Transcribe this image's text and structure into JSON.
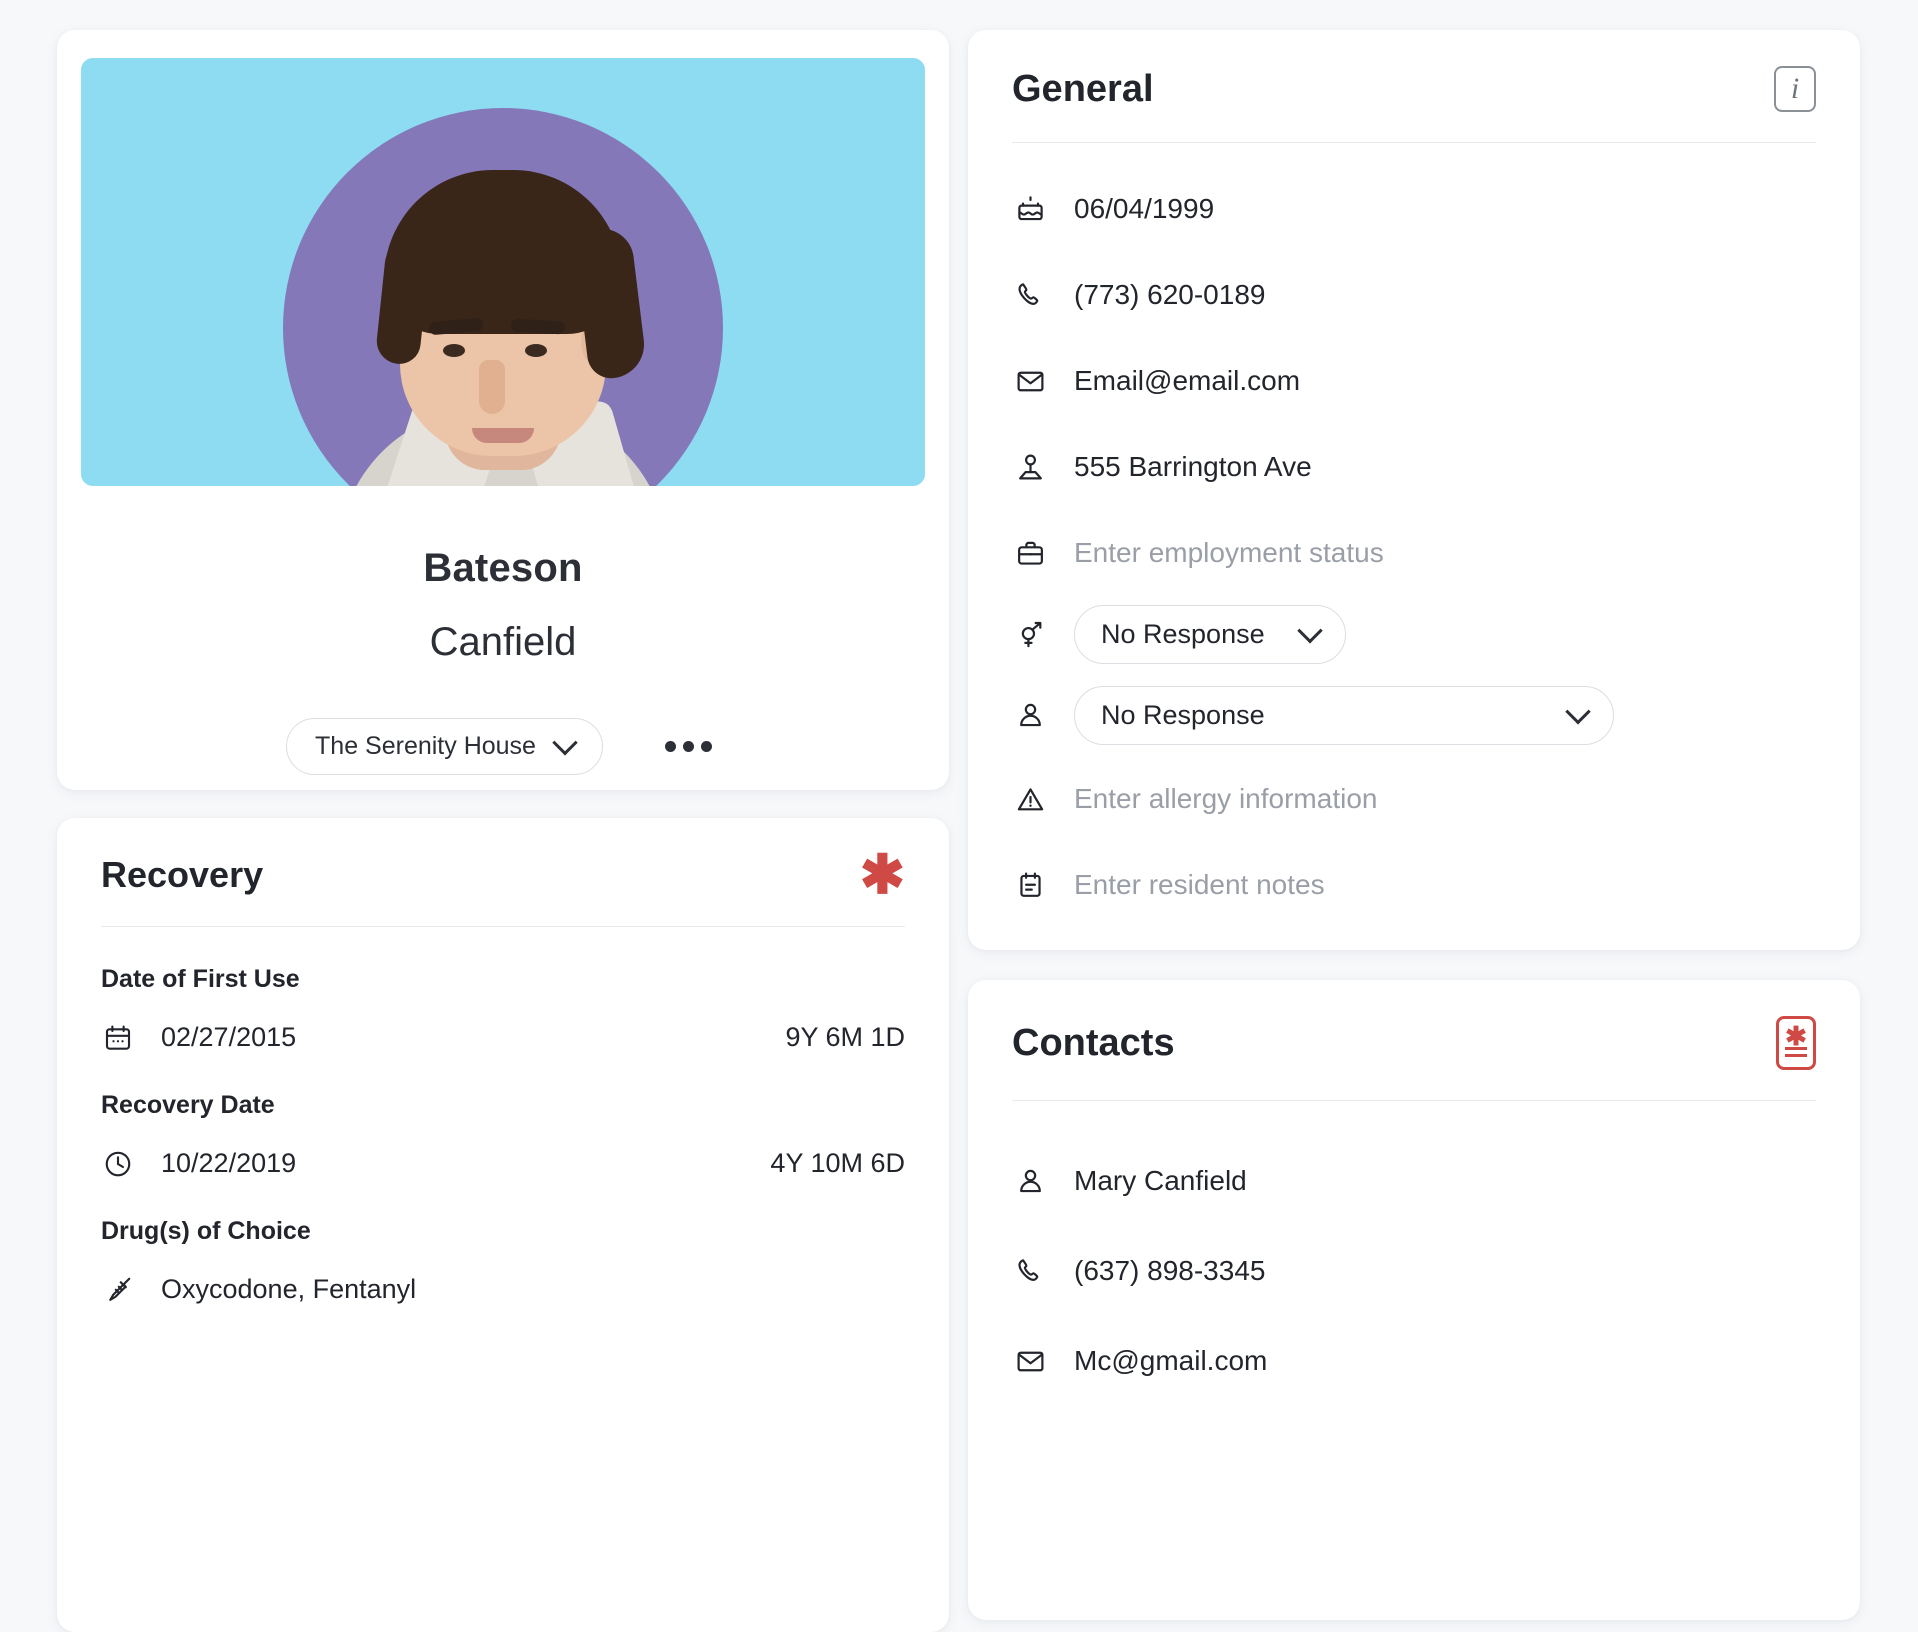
{
  "profile": {
    "first_name": "Bateson",
    "last_name": "Canfield",
    "house_select": "The Serenity House",
    "more_label": "•••",
    "banner_color": "#8edcf2",
    "avatar_bg_color": "#8478b8"
  },
  "recovery": {
    "title": "Recovery",
    "required_marker": "✱",
    "sections": [
      {
        "label": "Date of First Use",
        "icon": "calendar-icon",
        "value": "02/27/2015",
        "duration": "9Y 6M 1D"
      },
      {
        "label": "Recovery Date",
        "icon": "clock-icon",
        "value": "10/22/2019",
        "duration": "4Y 10M 6D"
      },
      {
        "label": "Drug(s) of Choice",
        "icon": "syringe-icon",
        "value": "Oxycodone, Fentanyl",
        "duration": ""
      }
    ]
  },
  "general": {
    "title": "General",
    "info_icon_label": "i",
    "rows": [
      {
        "icon": "birthday-cake-icon",
        "value": "06/04/1999",
        "placeholder": false
      },
      {
        "icon": "phone-icon",
        "value": "(773) 620-0189",
        "placeholder": false
      },
      {
        "icon": "envelope-icon",
        "value": "Email@email.com",
        "placeholder": false
      },
      {
        "icon": "location-pin-person-icon",
        "value": "555 Barrington Ave",
        "placeholder": false
      },
      {
        "icon": "briefcase-icon",
        "value": "Enter employment status",
        "placeholder": true
      }
    ],
    "gender_select": {
      "icon": "gender-intersex-icon",
      "value": "No Response"
    },
    "pronoun_select": {
      "icon": "person-icon",
      "value": "No Response"
    },
    "allergy_row": {
      "icon": "warning-triangle-icon",
      "value": "Enter allergy information",
      "placeholder": true
    },
    "notes_row": {
      "icon": "notes-icon",
      "value": "Enter resident notes",
      "placeholder": true
    }
  },
  "contacts": {
    "title": "Contacts",
    "badge_icon": "contact-card-required-icon",
    "rows": [
      {
        "icon": "person-icon",
        "value": "Mary Canfield"
      },
      {
        "icon": "phone-icon",
        "value": "(637) 898-3345"
      },
      {
        "icon": "envelope-icon",
        "value": "Mc@gmail.com"
      }
    ]
  },
  "colors": {
    "page_bg": "#f6f8fa",
    "card_bg": "#ffffff",
    "text": "#22252b",
    "placeholder": "#9a9ea6",
    "accent_red": "#cf4a44",
    "border": "#dcdee3"
  }
}
